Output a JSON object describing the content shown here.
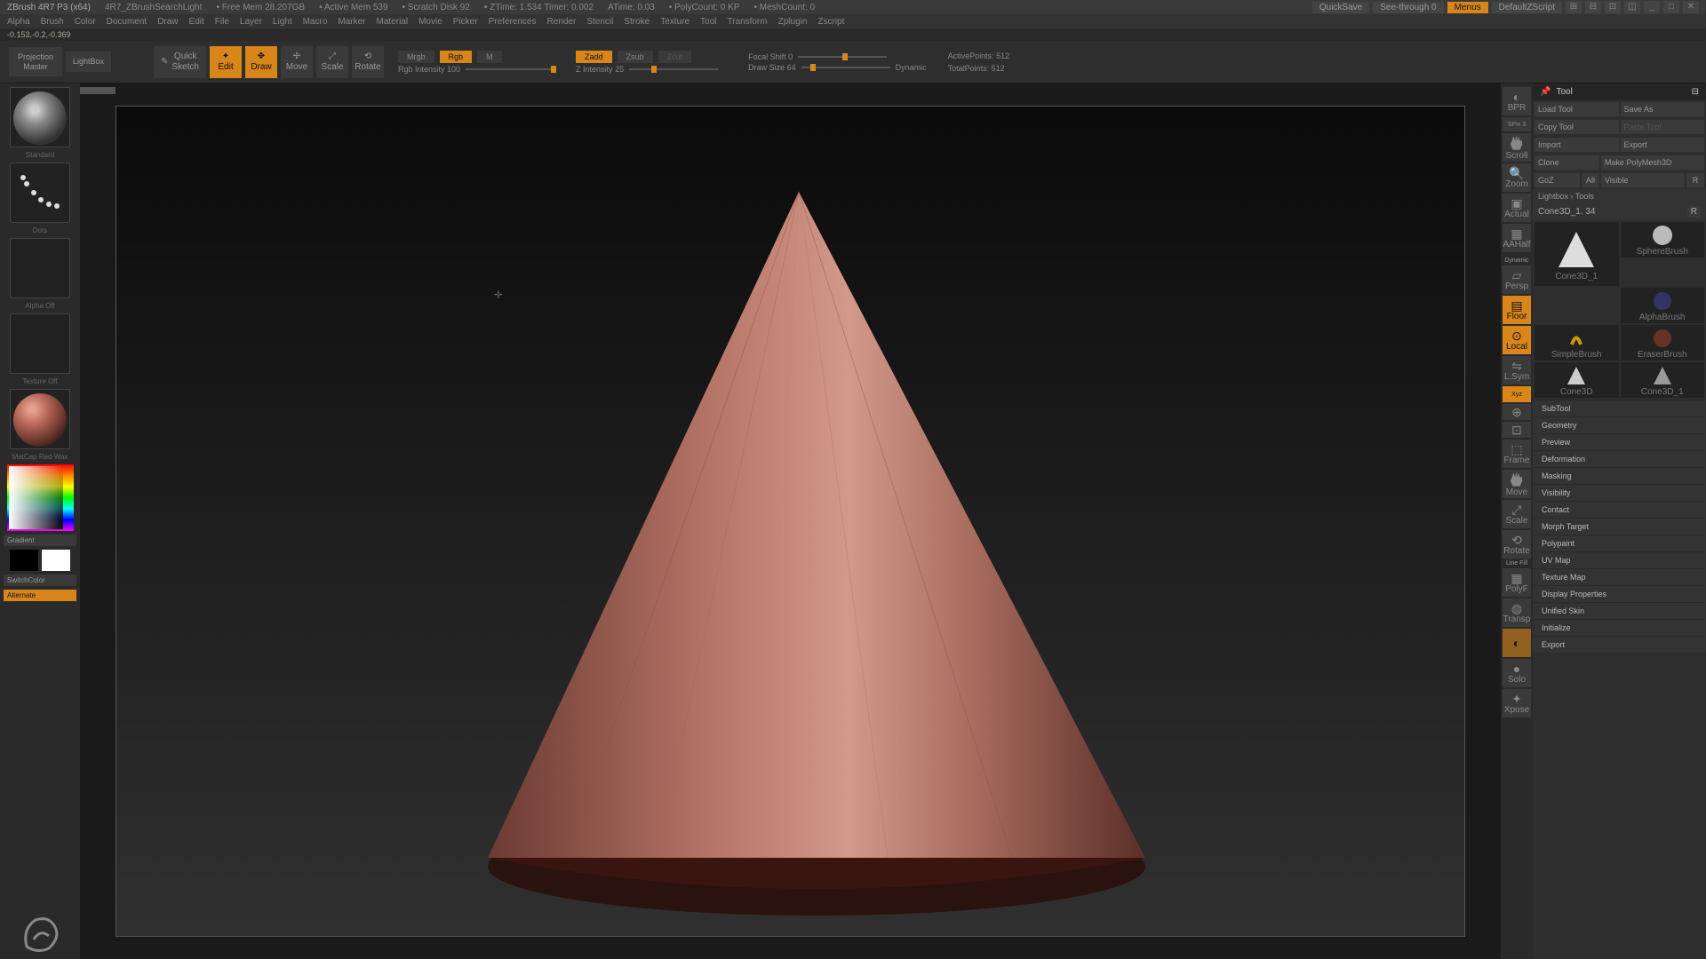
{
  "title_bar": {
    "app": "ZBrush 4R7 P3 (x64)",
    "file": "4R7_ZBrushSearchLight",
    "stats": [
      "• Free Mem 28.207GB",
      "• Active Mem 539",
      "• Scratch Disk 92",
      "• ZTime: 1.534 Timer: 0.002",
      "ATime: 0.03",
      "• PolyCount: 0 KP",
      "• MeshCount: 0"
    ],
    "quicksave": "QuickSave",
    "seethrough": "See-through   0",
    "menus": "Menus",
    "script": "DefaultZScript"
  },
  "menu": [
    "Alpha",
    "Brush",
    "Color",
    "Document",
    "Draw",
    "Edit",
    "File",
    "Layer",
    "Light",
    "Macro",
    "Marker",
    "Material",
    "Movie",
    "Picker",
    "Preferences",
    "Render",
    "Stencil",
    "Stroke",
    "Texture",
    "Tool",
    "Transform",
    "Zplugin",
    "Zscript"
  ],
  "coords": "-0.153,-0.2,-0.369",
  "toolbar": {
    "projection": "Projection\nMaster",
    "lightbox": "LightBox",
    "quicksketch": "Quick\nSketch",
    "edit": "Edit",
    "draw": "Draw",
    "move": "Move",
    "scale": "Scale",
    "rotate": "Rotate",
    "mrgb": "Mrgb",
    "rgb": "Rgb",
    "m": "M",
    "rgb_intensity": "Rgb Intensity 100",
    "zadd": "Zadd",
    "zsub": "Zsub",
    "zcut": "Zcut",
    "z_intensity": "Z Intensity 25",
    "focal": "Focal Shift 0",
    "drawsize": "Draw Size 64",
    "dynamic": "Dynamic",
    "active_pts": "ActivePoints: 512",
    "total_pts": "TotalPoints: 512"
  },
  "left": {
    "brush": "Standard",
    "stroke": "Dots",
    "alpha": "Alpha  Off",
    "texture": "Texture  Off",
    "material": "MatCap Red Wax",
    "gradient": "Gradient",
    "switch": "SwitchColor",
    "alternate": "Alternate"
  },
  "right_tools": {
    "bpr": "BPR",
    "spix": "SPix 3",
    "scroll": "Scroll",
    "zoom": "Zoom",
    "actual": "Actual",
    "aahalf": "AAHalf",
    "persp": "Persp",
    "dynamic_lbl": "Dynamic",
    "floor": "Floor",
    "local": "Local",
    "lsym": "L.Sym",
    "xyz": "Xyz",
    "frame": "Frame",
    "move": "Move",
    "scale": "Scale",
    "rotate": "Rotate",
    "linefill": "Line Fill",
    "polyf": "PolyF",
    "transp": "Transp",
    "solo": "Solo",
    "xpose": "Xpose"
  },
  "tool_panel": {
    "header": "Tool",
    "load": "Load Tool",
    "save": "Save As",
    "copy": "Copy Tool",
    "paste": "Paste Tool",
    "import": "Import",
    "export": "Export",
    "clone": "Clone",
    "polymesh": "Make PolyMesh3D",
    "goz": "GoZ",
    "all": "All",
    "visible": "Visible",
    "r": "R",
    "lbtools": "Lightbox › Tools",
    "current": "Cone3D_1. 34",
    "thumbs": [
      "Cone3D_1",
      "SphereBrush",
      "AlphaBrush",
      "SimpleBrush",
      "EraserBrush",
      "Cone3D",
      "Cone3D_1"
    ],
    "sections": [
      "SubTool",
      "Geometry",
      "Preview",
      "Deformation",
      "Masking",
      "Visibility",
      "Contact",
      "Morph Target",
      "Polypaint",
      "UV Map",
      "Texture Map",
      "Display Properties",
      "Unified Skin",
      "Initialize",
      "Export"
    ]
  }
}
